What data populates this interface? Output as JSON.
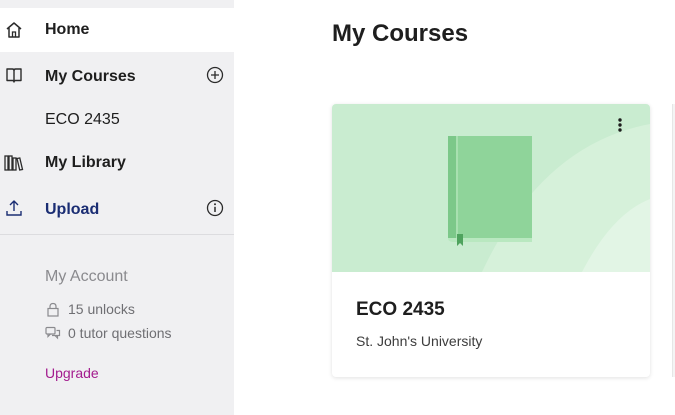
{
  "sidebar": {
    "nav": {
      "home": {
        "label": "Home",
        "icon": "home-icon"
      },
      "my_courses": {
        "label": "My Courses",
        "icon": "book-open-icon",
        "action_icon": "add-circle-icon"
      },
      "course_eco": {
        "label": "ECO 2435"
      },
      "my_library": {
        "label": "My Library",
        "icon": "library-icon"
      },
      "upload": {
        "label": "Upload",
        "icon": "upload-icon",
        "info_icon": "info-icon",
        "color": "#1a2d73"
      }
    },
    "account": {
      "title": "My Account",
      "unlocks": {
        "text": "15 unlocks",
        "icon": "lock-icon"
      },
      "tutor": {
        "text": "0 tutor questions",
        "icon": "chat-bubbles-icon"
      },
      "upgrade": {
        "label": "Upgrade",
        "color": "#a31b8e"
      }
    }
  },
  "main": {
    "title": "My Courses",
    "courses": [
      {
        "name": "ECO 2435",
        "school": "St. John's University",
        "banner_color": "#c9ecd0",
        "book_color": "#8fd49a",
        "icon": "book-icon"
      }
    ]
  }
}
